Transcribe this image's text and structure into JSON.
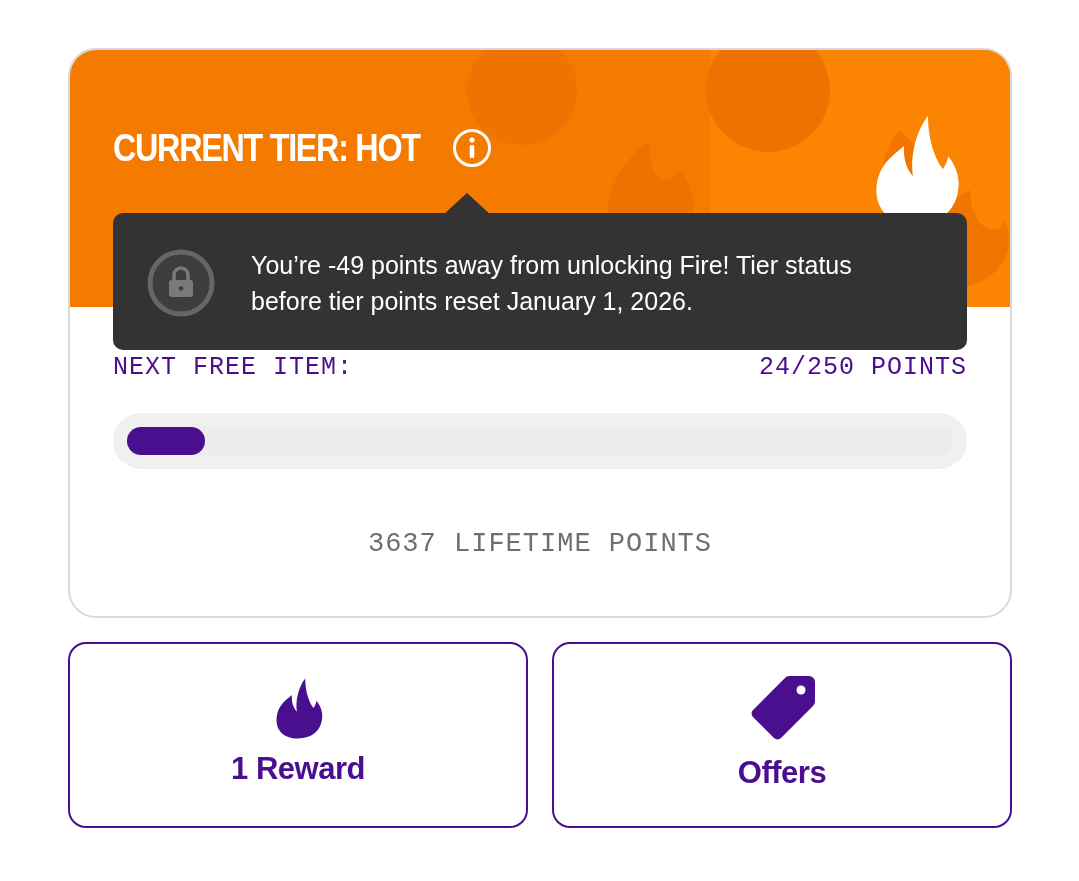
{
  "tier_card": {
    "title": "CURRENT TIER: HOT",
    "tooltip": {
      "text": "You’re -49 points away from unlocking Fire! Tier status before tier points reset January 1, 2026.",
      "locked": true
    },
    "next_item": {
      "label": "NEXT FREE ITEM:",
      "points": "24/250 POINTS",
      "level": 0.095
    },
    "lifetime": "3637 LIFETIME POINTS"
  },
  "actions": [
    {
      "kind": "reward",
      "label": "1 Reward"
    },
    {
      "kind": "offers",
      "label": "Offers"
    }
  ]
}
